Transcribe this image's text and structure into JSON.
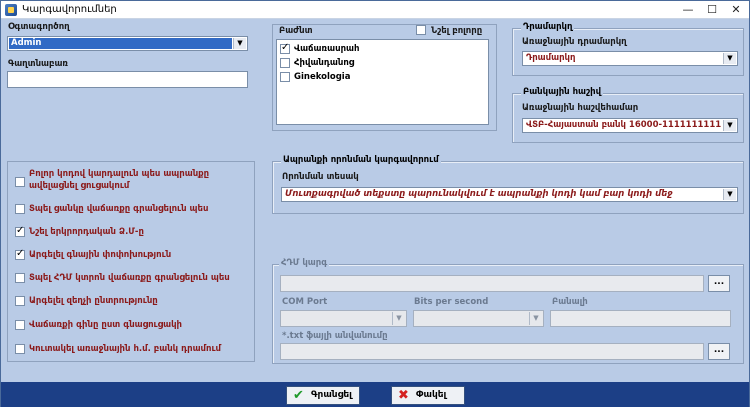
{
  "window": {
    "title": "Կարգավորումներ",
    "buttons": {
      "minimize": "—",
      "maximize": "☐",
      "close": "✕"
    }
  },
  "user": {
    "label": "Օգտագործող",
    "value": "Admin",
    "password_label": "Գաղտնաբառ",
    "password_value": ""
  },
  "departments": {
    "title": "Բաժնտ",
    "show_all_label": "Նշել բոլորը",
    "items": [
      {
        "label": "Վաճառասրահ",
        "checked": true
      },
      {
        "label": "Հիվանդանոց",
        "checked": false
      },
      {
        "label": "Ginekologia",
        "checked": false
      }
    ]
  },
  "cash_desk": {
    "title": "Դրամարկղ",
    "label": "Առաջնային դրամարկղ",
    "value": "Դրամարկղ"
  },
  "bank_account": {
    "title": "Բանկային հաշիվ",
    "label": "Առաջնային հաշվեհամար",
    "value": "ՎՏԲ-Հայաստան բանկ 16000-1111111111"
  },
  "options": [
    {
      "label": "Բոլոր կոդով կարդալուն պես ապրանքը",
      "label2": "ավելացնել ցուցակում",
      "checked": false
    },
    {
      "label": "Տպել ցանկը վաճառքը գրանցելուն պես",
      "checked": false
    },
    {
      "label": "Նշել երկրորդական Ձ.Մ-ը",
      "checked": true
    },
    {
      "label": "Արգելել գնային փոփոխություն",
      "checked": true
    },
    {
      "label": "Տպել ՀԴՄ կտրոն վաճառքը գրանցելուն պես",
      "checked": false
    },
    {
      "label": "Արգելել զեղչի ընտրությունը",
      "checked": false
    },
    {
      "label": "Վաճառքի գինը ըստ գնացուցակի",
      "checked": false
    },
    {
      "label": "Կուտակել առաջնային հ.մ. բանկ դրամում",
      "checked": false
    }
  ],
  "product_search": {
    "title": "Ապրանքի որոնման կարգավորում",
    "label": "Որոնման տեսակ",
    "value": "Մուտքագրված տեքստը պարունակվում է ապրանքի կոդի կամ բար կոդի մեջ"
  },
  "fiscal": {
    "title": "ՀԴՄ կարգ",
    "path_value": "",
    "browse_label": "...",
    "com_port_label": "COM Port",
    "bits_label": "Bits per second",
    "extra_label": "Բանալի",
    "txt_label": "*.txt ֆայլի անվանումը",
    "txt_value": "",
    "browse2_label": "..."
  },
  "footer": {
    "ok_label": "Գրանցել",
    "ok_icon": "check-icon",
    "cancel_label": "Փակել",
    "cancel_icon": "cross-icon"
  },
  "colors": {
    "background": "#b9cbe6",
    "footer": "#1c3f86",
    "selection": "#316ac5",
    "option_text": "#8b1a1a"
  }
}
